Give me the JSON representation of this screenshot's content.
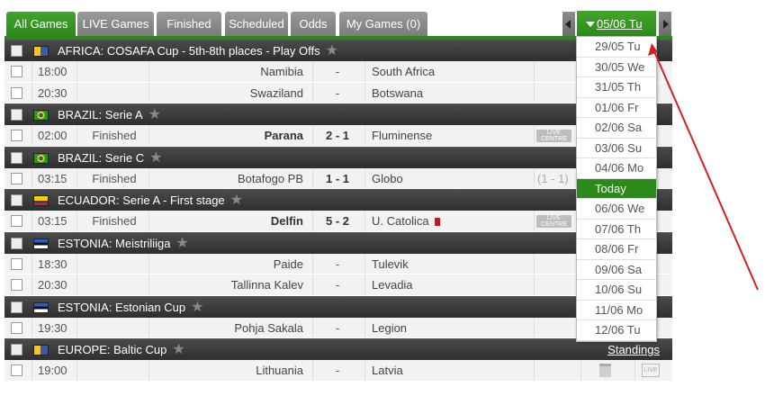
{
  "tabs": [
    {
      "label": "All Games",
      "active": true
    },
    {
      "label": "LIVE Games"
    },
    {
      "label": "Finished"
    },
    {
      "label": "Scheduled"
    },
    {
      "label": "Odds"
    },
    {
      "label": "My Games (0)"
    }
  ],
  "date_nav": {
    "current": "05/06 Tu"
  },
  "leagues": [
    {
      "name": "AFRICA: COSAFA Cup - 5th-8th places - Play Offs",
      "flag": "africa",
      "standings": "",
      "matches": [
        {
          "time": "18:00",
          "status": "",
          "home": "Namibia",
          "score": "-",
          "away": "South Africa"
        },
        {
          "time": "20:30",
          "status": "",
          "home": "Swaziland",
          "score": "-",
          "away": "Botswana"
        }
      ]
    },
    {
      "name": "BRAZIL: Serie A",
      "flag": "brazil",
      "standings": "",
      "matches": [
        {
          "time": "02:00",
          "status": "Finished",
          "home": "Parana",
          "score": "2 - 1",
          "away": "Fluminense",
          "winner": "home",
          "live_centre": "LIVE CENTRE"
        }
      ]
    },
    {
      "name": "BRAZIL: Serie C",
      "flag": "brazil",
      "standings": "",
      "matches": [
        {
          "time": "03:15",
          "status": "Finished",
          "home": "Botafogo PB",
          "score": "1 - 1",
          "away": "Globo",
          "ht": "(1 - 1)"
        }
      ]
    },
    {
      "name": "ECUADOR: Serie A - First stage",
      "flag": "ecuador",
      "standings": "",
      "matches": [
        {
          "time": "03:15",
          "status": "Finished",
          "home": "Delfin",
          "score": "5 - 2",
          "away": "U. Catolica",
          "winner": "home",
          "red_card": true,
          "live_centre": "LIVE CENTRE"
        }
      ]
    },
    {
      "name": "ESTONIA: Meistriliiga",
      "flag": "estonia",
      "standings": "",
      "matches": [
        {
          "time": "18:30",
          "status": "",
          "home": "Paide",
          "score": "-",
          "away": "Tulevik"
        },
        {
          "time": "20:30",
          "status": "",
          "home": "Tallinna Kalev",
          "score": "-",
          "away": "Levadia"
        }
      ]
    },
    {
      "name": "ESTONIA: Estonian Cup",
      "flag": "estonia",
      "standings": "",
      "matches": [
        {
          "time": "19:30",
          "status": "",
          "home": "Pohja Sakala",
          "score": "-",
          "away": "Legion"
        }
      ]
    },
    {
      "name": "EUROPE: Baltic Cup",
      "flag": "europe",
      "standings": "Standings",
      "matches": [
        {
          "time": "19:00",
          "status": "",
          "home": "Lithuania",
          "score": "-",
          "away": "Latvia",
          "tv": true,
          "live": "LIVE"
        }
      ]
    }
  ],
  "dropdown": {
    "items": [
      "29/05 Tu",
      "30/05 We",
      "31/05 Th",
      "01/06 Fr",
      "02/06 Sa",
      "03/06 Su",
      "04/06 Mo",
      "Today",
      "06/06 We",
      "07/06 Th",
      "08/06 Fr",
      "09/06 Sa",
      "10/06 Su",
      "11/06 Mo",
      "12/06 Tu"
    ],
    "highlighted": "Today"
  },
  "colors": {
    "accent": "#2b8a1a",
    "header_bg": "#3a3a3a",
    "row_bg": "#f2f2f2",
    "annotation_arrow": "#d42020"
  },
  "icons": {
    "checkbox": "checkbox-icon",
    "star": "star-icon",
    "tv": "tv-icon",
    "caret": "caret-down-icon"
  }
}
